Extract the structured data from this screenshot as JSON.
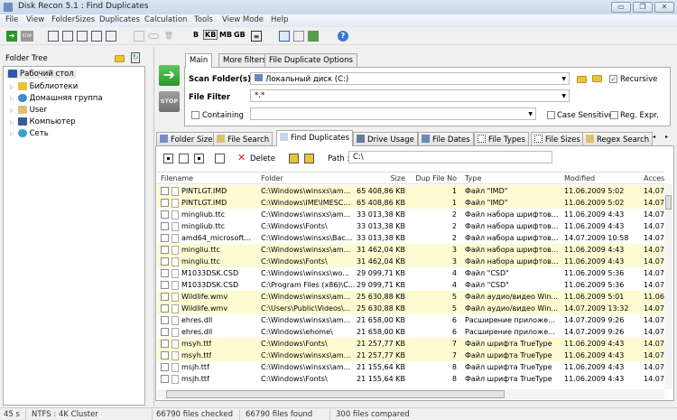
{
  "window": {
    "title": "Disk Recon 5.1 : Find Duplicates",
    "minimize": "▭",
    "restore": "❐",
    "close": "✕"
  },
  "menu": [
    "File",
    "View",
    "FolderSizes",
    "Duplicates",
    "Calculation",
    "Tools",
    "View Mode",
    "Help"
  ],
  "toolbar": {
    "units": [
      "B",
      "KB",
      "MB",
      "GB"
    ],
    "selected_unit": "KB"
  },
  "folder_tree": {
    "title": "Folder Tree",
    "root": "Рабочий стол",
    "items": [
      "Библиотеки",
      "Домашняя группа",
      "User",
      "Компьютер",
      "Сеть"
    ]
  },
  "options": {
    "tabs": [
      "Main",
      "More filters",
      "File Duplicate Options"
    ],
    "active_tab": "Main",
    "scan_folder_label": "Scan Folder(s)",
    "scan_folder_value": "Локальный диск (C:)",
    "file_filter_label": "File Filter",
    "file_filter_value": "*.*",
    "containing_label": "Containing",
    "containing_value": "",
    "recursive_label": "Recursive",
    "recursive_checked": true,
    "case_sensitive_label": "Case Sensitive",
    "regex_label": "Reg. Expr.",
    "go": "➔",
    "stop": "STOP"
  },
  "main_tabs": [
    "Folder Sizes",
    "File Search",
    "Find Duplicates",
    "Drive Usage",
    "File Dates",
    "File Types",
    "File Sizes",
    "Regex Search"
  ],
  "active_main_tab": "Find Duplicates",
  "dup_toolbar": {
    "delete_label": "Delete",
    "path_label": "Path :",
    "path_value": "C:\\"
  },
  "table": {
    "columns": [
      "Filename",
      "Folder",
      "Size",
      "Dup File No",
      "Type",
      "Modified",
      "Accessed"
    ],
    "rows": [
      {
        "name": "PINTLGT.IMD",
        "folder": "C:\\Windows\\winsxs\\am...",
        "size": "65 408,86 KB",
        "dup": "1",
        "type": "Файл \"IMD\"",
        "modified": "11.06.2009 5:02",
        "accessed": "14.07",
        "hl": true
      },
      {
        "name": "PINTLGT.IMD",
        "folder": "C:\\Windows\\IME\\IMESC...",
        "size": "65 408,86 KB",
        "dup": "1",
        "type": "Файл \"IMD\"",
        "modified": "11.06.2009 5:02",
        "accessed": "14.07",
        "hl": true
      },
      {
        "name": "mingliub.ttc",
        "folder": "C:\\Windows\\winsxs\\am...",
        "size": "33 013,38 KB",
        "dup": "2",
        "type": "Файл набора шрифтов...",
        "modified": "11.06.2009 4:43",
        "accessed": "14.07",
        "hl": false
      },
      {
        "name": "mingliub.ttc",
        "folder": "C:\\Windows\\Fonts\\",
        "size": "33 013,38 KB",
        "dup": "2",
        "type": "Файл набора шрифтов...",
        "modified": "11.06.2009 4:43",
        "accessed": "14.07",
        "hl": false
      },
      {
        "name": "amd64_microsoft...",
        "folder": "C:\\Windows\\winsxs\\Bac...",
        "size": "33 013,38 KB",
        "dup": "2",
        "type": "Файл набора шрифтов...",
        "modified": "14.07.2009 10:58",
        "accessed": "14.07",
        "hl": false
      },
      {
        "name": "mingliu.ttc",
        "folder": "C:\\Windows\\winsxs\\am...",
        "size": "31 462,04 KB",
        "dup": "3",
        "type": "Файл набора шрифтов...",
        "modified": "11.06.2009 4:43",
        "accessed": "14.07",
        "hl": true
      },
      {
        "name": "mingliu.ttc",
        "folder": "C:\\Windows\\Fonts\\",
        "size": "31 462,04 KB",
        "dup": "3",
        "type": "Файл набора шрифтов...",
        "modified": "11.06.2009 4:43",
        "accessed": "14.07",
        "hl": true
      },
      {
        "name": "M1033DSK.CSD",
        "folder": "C:\\Windows\\winsxs\\wo...",
        "size": "29 099,71 KB",
        "dup": "4",
        "type": "Файл \"CSD\"",
        "modified": "11.06.2009 5:36",
        "accessed": "14.07",
        "hl": false
      },
      {
        "name": "M1033DSK.CSD",
        "folder": "C:\\Program Files (x86)\\C...",
        "size": "29 099,71 KB",
        "dup": "4",
        "type": "Файл \"CSD\"",
        "modified": "11.06.2009 5:36",
        "accessed": "14.07",
        "hl": false
      },
      {
        "name": "Wildlife.wmv",
        "folder": "C:\\Windows\\winsxs\\am...",
        "size": "25 630,88 KB",
        "dup": "5",
        "type": "Файл аудио/видео Win...",
        "modified": "11.06.2009 5:01",
        "accessed": "11.06",
        "hl": true
      },
      {
        "name": "Wildlife.wmv",
        "folder": "C:\\Users\\Public\\Videos\\...",
        "size": "25 630,88 KB",
        "dup": "5",
        "type": "Файл аудио/видео Win...",
        "modified": "14.07.2009 13:32",
        "accessed": "14.07",
        "hl": true
      },
      {
        "name": "ehres.dll",
        "folder": "C:\\Windows\\winsxs\\am...",
        "size": "21 658,00 KB",
        "dup": "6",
        "type": "Расширение приложе...",
        "modified": "14.07.2009 9:26",
        "accessed": "14.07",
        "hl": false
      },
      {
        "name": "ehres.dll",
        "folder": "C:\\Windows\\ehome\\",
        "size": "21 658,00 KB",
        "dup": "6",
        "type": "Расширение приложе...",
        "modified": "14.07.2009 9:26",
        "accessed": "14.07",
        "hl": false
      },
      {
        "name": "msyh.ttf",
        "folder": "C:\\Windows\\Fonts\\",
        "size": "21 257,77 KB",
        "dup": "7",
        "type": "Файл шрифта TrueType",
        "modified": "11.06.2009 4:43",
        "accessed": "14.07",
        "hl": true
      },
      {
        "name": "msyh.ttf",
        "folder": "C:\\Windows\\winsxs\\am...",
        "size": "21 257,77 KB",
        "dup": "7",
        "type": "Файл шрифта TrueType",
        "modified": "11.06.2009 4:43",
        "accessed": "14.07",
        "hl": true
      },
      {
        "name": "msjh.ttf",
        "folder": "C:\\Windows\\winsxs\\am...",
        "size": "21 155,64 KB",
        "dup": "8",
        "type": "Файл шрифта TrueType",
        "modified": "11.06.2009 4:43",
        "accessed": "14.07",
        "hl": false
      },
      {
        "name": "msjh.ttf",
        "folder": "C:\\Windows\\Fonts\\",
        "size": "21 155,64 KB",
        "dup": "8",
        "type": "Файл шрифта TrueType",
        "modified": "11.06.2009 4:43",
        "accessed": "14.07",
        "hl": false
      }
    ]
  },
  "status": {
    "time": "45 s",
    "fs": "NTFS : 4K Cluster",
    "checked": "66790 files checked",
    "found": "66790 files found",
    "compared": "300 files compared"
  },
  "colors": {
    "highlight": "#fdfbd2",
    "go": "#2a962a",
    "delete": "#d42020"
  }
}
